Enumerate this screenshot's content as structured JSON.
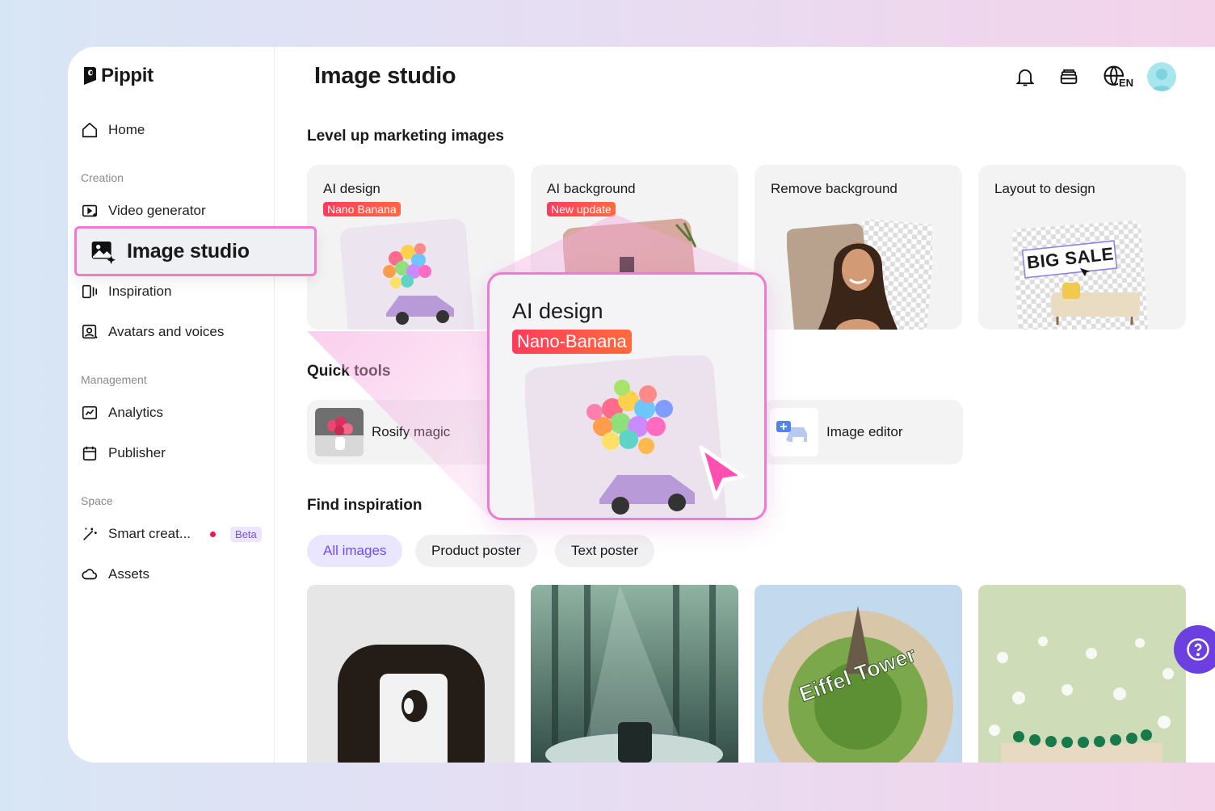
{
  "app": {
    "brand": "Pippit"
  },
  "sidebar": {
    "home": "Home",
    "sections": {
      "creation": "Creation",
      "management": "Management",
      "space": "Space"
    },
    "items": {
      "video_generator": "Video generator",
      "image_studio": "Image studio",
      "inspiration": "Inspiration",
      "avatars": "Avatars and voices",
      "analytics": "Analytics",
      "publisher": "Publisher",
      "smart_creation": "Smart creat...",
      "smart_creation_badge": "Beta",
      "assets": "Assets"
    }
  },
  "header": {
    "title": "Image studio",
    "language": "EN"
  },
  "marketing": {
    "heading": "Level up marketing images",
    "cards": [
      {
        "title": "AI design",
        "tag": "Nano Banana"
      },
      {
        "title": "AI background",
        "tag": "New update"
      },
      {
        "title": "Remove background"
      },
      {
        "title": "Layout to design",
        "sample_text": "BIG SALE"
      }
    ]
  },
  "quick_tools": {
    "heading": "Quick tools",
    "items": [
      {
        "label": "Rosify magic"
      },
      {
        "label": "Image editor"
      }
    ]
  },
  "inspiration": {
    "heading": "Find inspiration",
    "filters": [
      "All images",
      "Product poster",
      "Text poster"
    ],
    "active_filter": "All images",
    "tiles": [
      {
        "alt": "fur-logo"
      },
      {
        "alt": "forest-product"
      },
      {
        "alt": "eiffel-globe",
        "text": "Eiffel Tower"
      },
      {
        "alt": "bracelet-meadow"
      }
    ]
  },
  "popup": {
    "title": "AI design",
    "tag": "Nano-Banana"
  },
  "colors": {
    "accent": "#f07ad0",
    "brand_purple": "#6b3fe0",
    "tag_red": "#ff4a4a",
    "chip_active": "#6c4ef0"
  }
}
